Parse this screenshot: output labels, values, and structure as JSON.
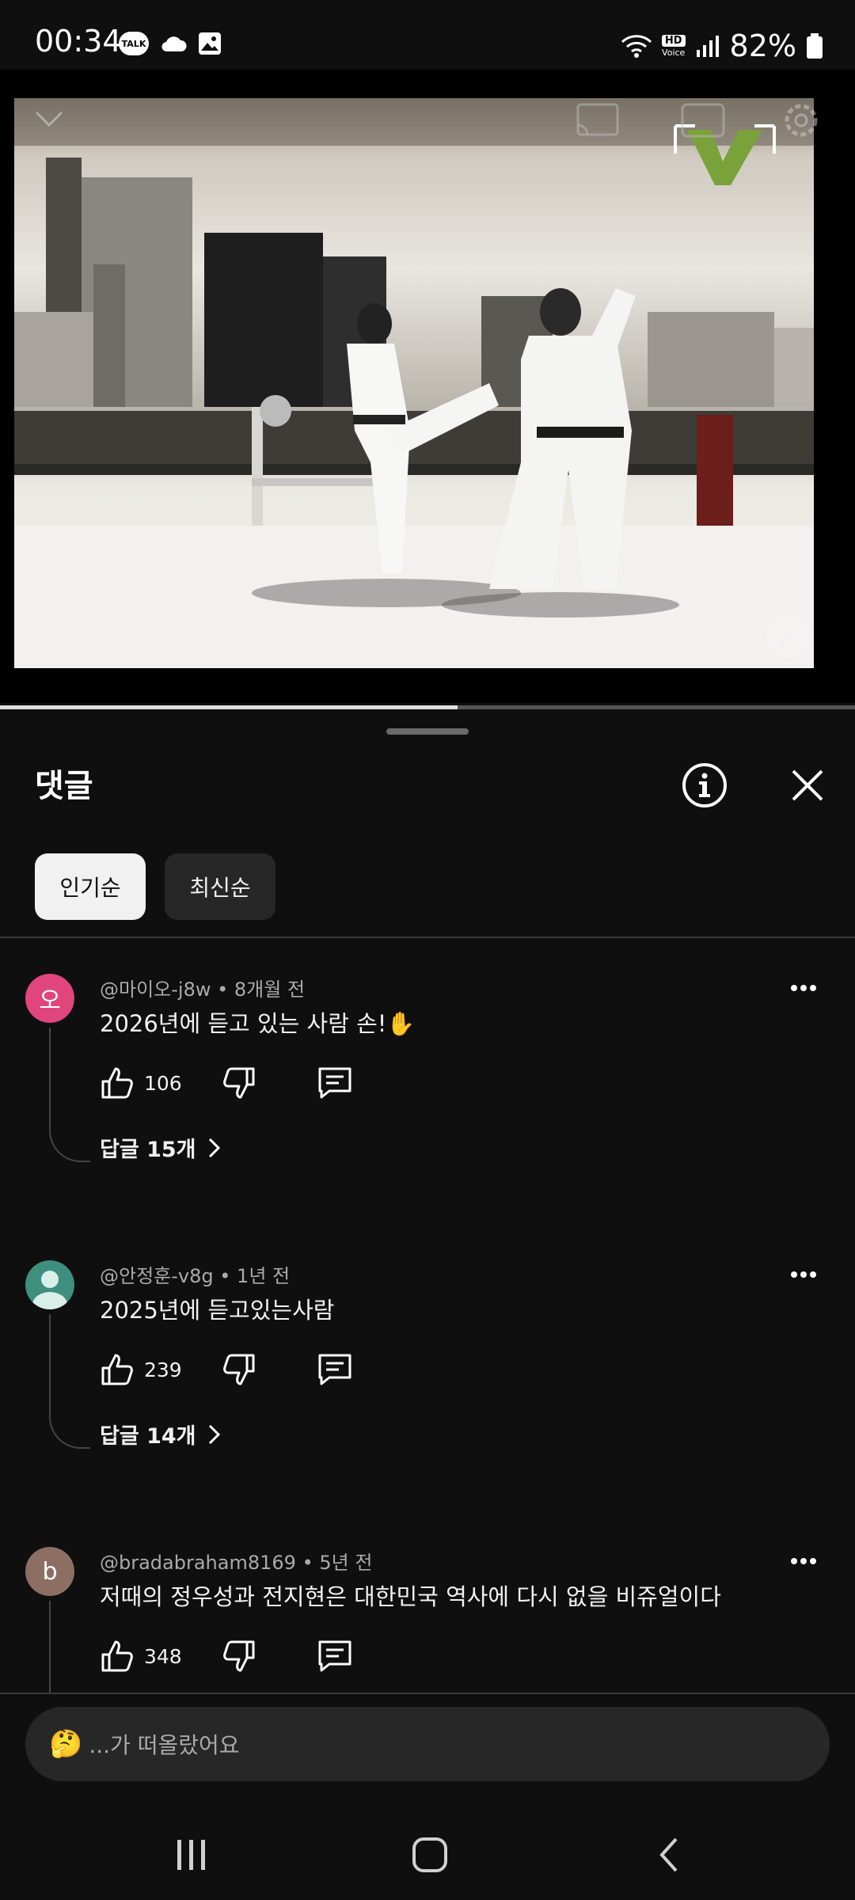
{
  "status_bar": {
    "time": "00:34",
    "talk_badge": "TALK",
    "hd_badge": "HD",
    "voice_badge": "Voice",
    "battery": "82%"
  },
  "video": {
    "progress": 0.535
  },
  "comments_sheet": {
    "title": "댓글",
    "filters": [
      {
        "label": "인기순",
        "active": true
      },
      {
        "label": "최신순",
        "active": false
      }
    ],
    "comments": [
      {
        "avatar_letter": "오",
        "avatar_color": "#e0457b",
        "author": "@마이오-j8w",
        "age": "8개월 전",
        "text": "2026년에 듣고 있는 사람 손!✋",
        "likes": "106",
        "replies_label": "답글 15개"
      },
      {
        "avatar_letter": "",
        "avatar_color": "#3e8f7e",
        "author": "@안정훈-v8g",
        "age": "1년 전",
        "text": "2025년에 듣고있는사람",
        "likes": "239",
        "replies_label": "답글 14개"
      },
      {
        "avatar_letter": "b",
        "avatar_color": "#8d6e63",
        "author": "@bradabraham8169",
        "age": "5년 전",
        "text": "저때의 정우성과 전지현은 대한민국 역사에 다시 없을 비쥬얼이다",
        "likes": "348",
        "replies_label": ""
      }
    ],
    "meta_separator": "•"
  },
  "input": {
    "emoji": "🤔",
    "placeholder": "...가 떠올랐어요"
  }
}
